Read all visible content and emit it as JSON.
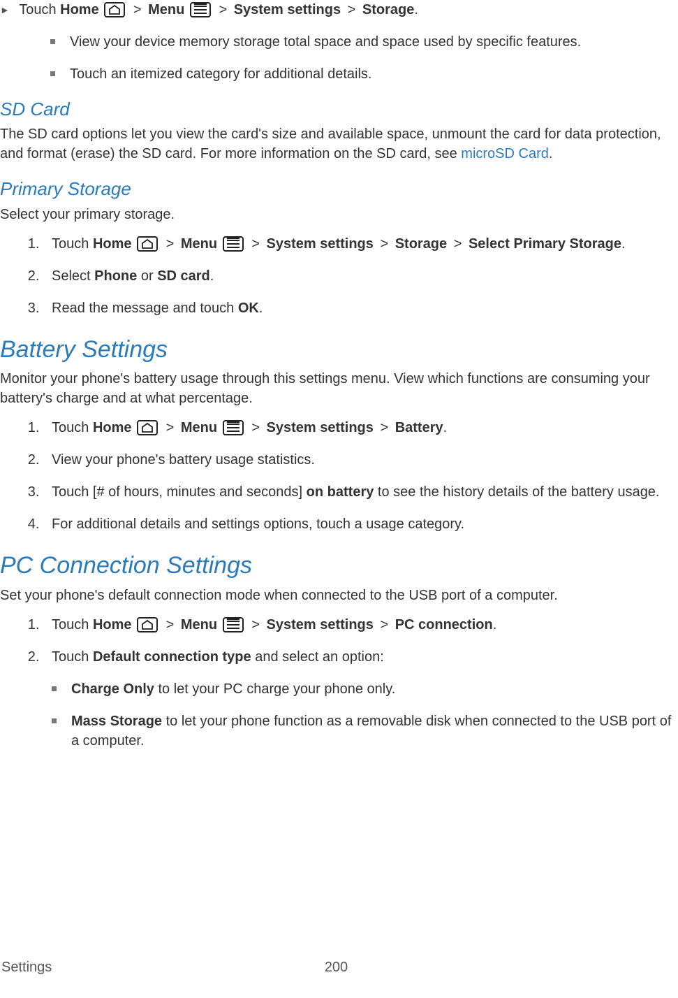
{
  "intro": {
    "touch": "Touch ",
    "home": "Home",
    "menu": "Menu",
    "syssettings": "System settings",
    "storage": "Storage",
    "bullets": [
      "View your device memory storage total space and space used by specific features.",
      "Touch an itemized category for additional details."
    ]
  },
  "sdcard": {
    "heading": "SD Card",
    "text1": "The SD card options let you view the card's size and available space, unmount the card for data protection, and format (erase) the SD card. For more information on the SD card, see ",
    "link": "microSD Card",
    "period": "."
  },
  "primary": {
    "heading": "Primary Storage",
    "intro": "Select your primary storage.",
    "step1": {
      "touch": "Touch ",
      "home": "Home",
      "menu": "Menu",
      "syssettings": "System settings",
      "storage": "Storage",
      "selectprimary": "Select Primary Storage",
      "period": "."
    },
    "step2": {
      "select": "Select ",
      "phone": "Phone",
      "or": " or ",
      "sdcard": "SD card",
      "period": "."
    },
    "step3": {
      "text": "Read the message and touch ",
      "ok": "OK",
      "period": "."
    }
  },
  "battery": {
    "heading": "Battery Settings",
    "intro": "Monitor your phone's battery usage through this settings menu. View which functions are consuming your battery's charge and at what percentage.",
    "step1": {
      "touch": "Touch ",
      "home": "Home",
      "menu": "Menu",
      "syssettings": "System settings",
      "battery": "Battery",
      "period": "."
    },
    "step2": "View your phone's battery usage statistics.",
    "step3": {
      "a": "Touch [# of hours, minutes and seconds] ",
      "bold": "on battery",
      "b": " to see the history details of the battery usage."
    },
    "step4": "For additional details and settings options, touch a usage category."
  },
  "pc": {
    "heading": "PC Connection Settings",
    "intro": "Set your phone's default connection mode when connected to the USB port of a computer.",
    "step1": {
      "touch": "Touch ",
      "home": "Home",
      "menu": "Menu",
      "syssettings": "System settings",
      "pcconn": "PC connection",
      "period": "."
    },
    "step2": {
      "a": "Touch ",
      "bold": "Default connection type",
      "b": " and select an option:"
    },
    "bullets": {
      "b1": {
        "bold": "Charge Only",
        "text": " to let your PC charge your phone only."
      },
      "b2": {
        "bold": "Mass Storage",
        "text": " to let your phone function as a removable disk when connected to the USB port of a computer."
      }
    }
  },
  "footer": {
    "section": "Settings",
    "page": "200"
  },
  "glyphs": {
    "gt": ">"
  }
}
